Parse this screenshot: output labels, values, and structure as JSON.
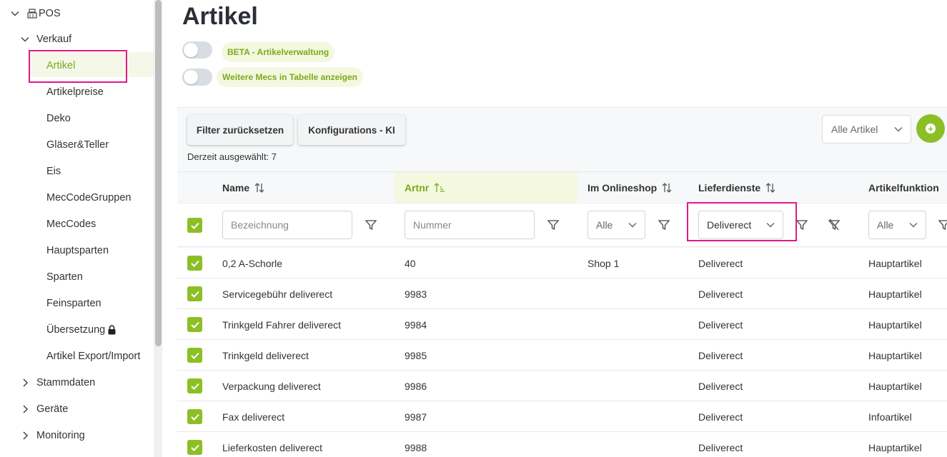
{
  "sidebar": {
    "root": {
      "label": "POS",
      "icon": "register-icon"
    },
    "verkauf": {
      "label": "Verkauf"
    },
    "items": [
      {
        "label": "Artikel",
        "active": true
      },
      {
        "label": "Artikelpreise"
      },
      {
        "label": "Deko"
      },
      {
        "label": "Gläser&Teller"
      },
      {
        "label": "Eis"
      },
      {
        "label": "MecCodeGruppen"
      },
      {
        "label": "MecCodes"
      },
      {
        "label": "Hauptsparten"
      },
      {
        "label": "Sparten"
      },
      {
        "label": "Feinsparten"
      },
      {
        "label": "Übersetzung",
        "icon": "lock-icon"
      },
      {
        "label": "Artikel Export/Import"
      }
    ],
    "groups": [
      {
        "label": "Stammdaten"
      },
      {
        "label": "Geräte"
      },
      {
        "label": "Monitoring"
      }
    ]
  },
  "page": {
    "title": "Artikel",
    "toggles": [
      {
        "label": "BETA - Artikelverwaltung",
        "on": false
      },
      {
        "label": "Weitere Mecs in Tabelle anzeigen",
        "on": false
      }
    ]
  },
  "toolbar": {
    "reset_filter": "Filter zurücksetzen",
    "config_ki": "Konfigurations - KI",
    "selected_text": "Derzeit ausgewählt: 7",
    "article_select": "Alle Artikel"
  },
  "table": {
    "columns": {
      "name": "Name",
      "artnr": "Artnr",
      "onlineshop": "Im Onlineshop",
      "lieferdienste": "Lieferdienste",
      "artikelfunktion": "Artikelfunktion"
    },
    "filters": {
      "name_placeholder": "Bezeichnung",
      "artnr_placeholder": "Nummer",
      "onlineshop_value": "Alle",
      "lieferdienste_value": "Deliverect",
      "artikelfunktion_value": "Alle"
    },
    "rows": [
      {
        "name": "0,2 A-Schorle",
        "artnr": "40",
        "shop": "Shop 1",
        "liefer": "Deliverect",
        "funktion": "Hauptartikel"
      },
      {
        "name": "Servicegebühr deliverect",
        "artnr": "9983",
        "shop": "",
        "liefer": "Deliverect",
        "funktion": "Hauptartikel"
      },
      {
        "name": "Trinkgeld Fahrer deliverect",
        "artnr": "9984",
        "shop": "",
        "liefer": "Deliverect",
        "funktion": "Hauptartikel"
      },
      {
        "name": "Trinkgeld deliverect",
        "artnr": "9985",
        "shop": "",
        "liefer": "Deliverect",
        "funktion": "Hauptartikel"
      },
      {
        "name": "Verpackung deliverect",
        "artnr": "9986",
        "shop": "",
        "liefer": "Deliverect",
        "funktion": "Hauptartikel"
      },
      {
        "name": "Fax deliverect",
        "artnr": "9987",
        "shop": "",
        "liefer": "Deliverect",
        "funktion": "Infoartikel"
      },
      {
        "name": "Lieferkosten deliverect",
        "artnr": "9988",
        "shop": "",
        "liefer": "Deliverect",
        "funktion": "Hauptartikel"
      }
    ]
  },
  "colors": {
    "accent": "#8cbf26",
    "accent_text": "#7aaa1c",
    "highlight": "#e0198a"
  }
}
